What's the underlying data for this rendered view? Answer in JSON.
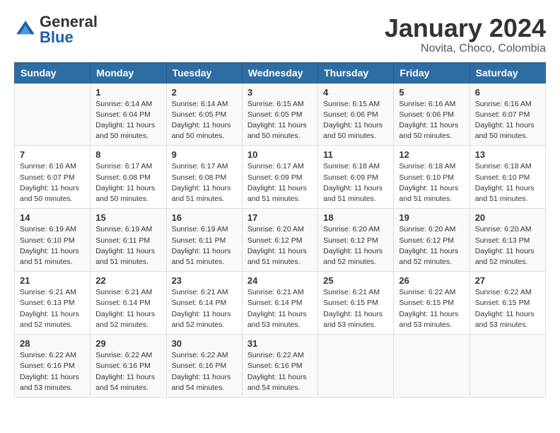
{
  "header": {
    "logo_general": "General",
    "logo_blue": "Blue",
    "title": "January 2024",
    "subtitle": "Novita, Choco, Colombia"
  },
  "weekdays": [
    "Sunday",
    "Monday",
    "Tuesday",
    "Wednesday",
    "Thursday",
    "Friday",
    "Saturday"
  ],
  "weeks": [
    [
      {
        "day": "",
        "info": ""
      },
      {
        "day": "1",
        "info": "Sunrise: 6:14 AM\nSunset: 6:04 PM\nDaylight: 11 hours\nand 50 minutes."
      },
      {
        "day": "2",
        "info": "Sunrise: 6:14 AM\nSunset: 6:05 PM\nDaylight: 11 hours\nand 50 minutes."
      },
      {
        "day": "3",
        "info": "Sunrise: 6:15 AM\nSunset: 6:05 PM\nDaylight: 11 hours\nand 50 minutes."
      },
      {
        "day": "4",
        "info": "Sunrise: 6:15 AM\nSunset: 6:06 PM\nDaylight: 11 hours\nand 50 minutes."
      },
      {
        "day": "5",
        "info": "Sunrise: 6:16 AM\nSunset: 6:06 PM\nDaylight: 11 hours\nand 50 minutes."
      },
      {
        "day": "6",
        "info": "Sunrise: 6:16 AM\nSunset: 6:07 PM\nDaylight: 11 hours\nand 50 minutes."
      }
    ],
    [
      {
        "day": "7",
        "info": "Sunrise: 6:16 AM\nSunset: 6:07 PM\nDaylight: 11 hours\nand 50 minutes."
      },
      {
        "day": "8",
        "info": "Sunrise: 6:17 AM\nSunset: 6:08 PM\nDaylight: 11 hours\nand 50 minutes."
      },
      {
        "day": "9",
        "info": "Sunrise: 6:17 AM\nSunset: 6:08 PM\nDaylight: 11 hours\nand 51 minutes."
      },
      {
        "day": "10",
        "info": "Sunrise: 6:17 AM\nSunset: 6:09 PM\nDaylight: 11 hours\nand 51 minutes."
      },
      {
        "day": "11",
        "info": "Sunrise: 6:18 AM\nSunset: 6:09 PM\nDaylight: 11 hours\nand 51 minutes."
      },
      {
        "day": "12",
        "info": "Sunrise: 6:18 AM\nSunset: 6:10 PM\nDaylight: 11 hours\nand 51 minutes."
      },
      {
        "day": "13",
        "info": "Sunrise: 6:18 AM\nSunset: 6:10 PM\nDaylight: 11 hours\nand 51 minutes."
      }
    ],
    [
      {
        "day": "14",
        "info": "Sunrise: 6:19 AM\nSunset: 6:10 PM\nDaylight: 11 hours\nand 51 minutes."
      },
      {
        "day": "15",
        "info": "Sunrise: 6:19 AM\nSunset: 6:11 PM\nDaylight: 11 hours\nand 51 minutes."
      },
      {
        "day": "16",
        "info": "Sunrise: 6:19 AM\nSunset: 6:11 PM\nDaylight: 11 hours\nand 51 minutes."
      },
      {
        "day": "17",
        "info": "Sunrise: 6:20 AM\nSunset: 6:12 PM\nDaylight: 11 hours\nand 51 minutes."
      },
      {
        "day": "18",
        "info": "Sunrise: 6:20 AM\nSunset: 6:12 PM\nDaylight: 11 hours\nand 52 minutes."
      },
      {
        "day": "19",
        "info": "Sunrise: 6:20 AM\nSunset: 6:12 PM\nDaylight: 11 hours\nand 52 minutes."
      },
      {
        "day": "20",
        "info": "Sunrise: 6:20 AM\nSunset: 6:13 PM\nDaylight: 11 hours\nand 52 minutes."
      }
    ],
    [
      {
        "day": "21",
        "info": "Sunrise: 6:21 AM\nSunset: 6:13 PM\nDaylight: 11 hours\nand 52 minutes."
      },
      {
        "day": "22",
        "info": "Sunrise: 6:21 AM\nSunset: 6:14 PM\nDaylight: 11 hours\nand 52 minutes."
      },
      {
        "day": "23",
        "info": "Sunrise: 6:21 AM\nSunset: 6:14 PM\nDaylight: 11 hours\nand 52 minutes."
      },
      {
        "day": "24",
        "info": "Sunrise: 6:21 AM\nSunset: 6:14 PM\nDaylight: 11 hours\nand 53 minutes."
      },
      {
        "day": "25",
        "info": "Sunrise: 6:21 AM\nSunset: 6:15 PM\nDaylight: 11 hours\nand 53 minutes."
      },
      {
        "day": "26",
        "info": "Sunrise: 6:22 AM\nSunset: 6:15 PM\nDaylight: 11 hours\nand 53 minutes."
      },
      {
        "day": "27",
        "info": "Sunrise: 6:22 AM\nSunset: 6:15 PM\nDaylight: 11 hours\nand 53 minutes."
      }
    ],
    [
      {
        "day": "28",
        "info": "Sunrise: 6:22 AM\nSunset: 6:16 PM\nDaylight: 11 hours\nand 53 minutes."
      },
      {
        "day": "29",
        "info": "Sunrise: 6:22 AM\nSunset: 6:16 PM\nDaylight: 11 hours\nand 54 minutes."
      },
      {
        "day": "30",
        "info": "Sunrise: 6:22 AM\nSunset: 6:16 PM\nDaylight: 11 hours\nand 54 minutes."
      },
      {
        "day": "31",
        "info": "Sunrise: 6:22 AM\nSunset: 6:16 PM\nDaylight: 11 hours\nand 54 minutes."
      },
      {
        "day": "",
        "info": ""
      },
      {
        "day": "",
        "info": ""
      },
      {
        "day": "",
        "info": ""
      }
    ]
  ]
}
